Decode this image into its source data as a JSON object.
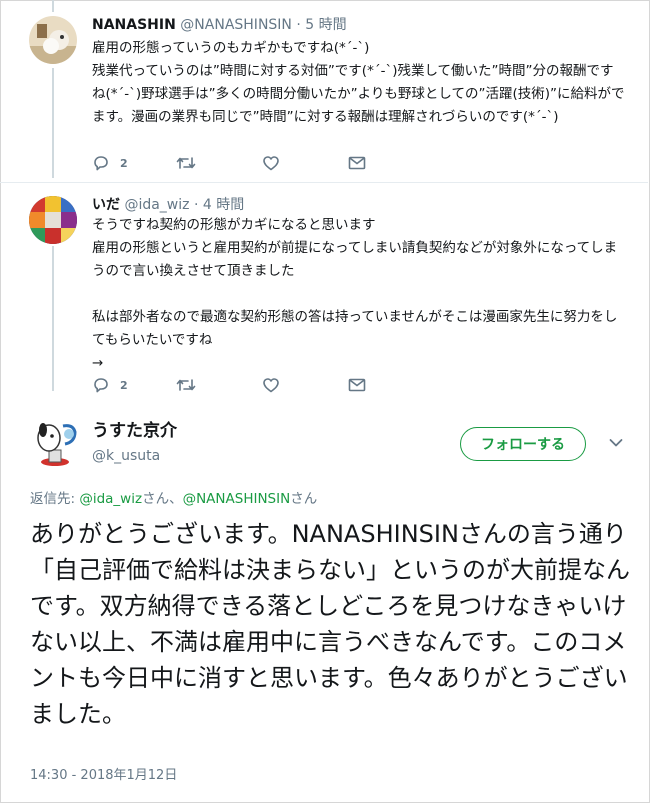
{
  "tweets": [
    {
      "display_name": "NANASHIN",
      "handle": "@NANASHINSIN",
      "time": "5 時間",
      "text": "雇用の形態っていうのもカギかもですね(*´-`)\n残業代っていうのは”時間に対する対価”です(*´-`)残業して働いた”時間”分の報酬ですね(*´-`)野球選手は”多くの時間分働いたか”よりも野球としての”活躍(技術)”に給料がでます。漫画の業界も同じで”時間”に対する報酬は理解されづらいのです(*´-`)",
      "reply_count": "2"
    },
    {
      "display_name": "いだ",
      "handle": "@ida_wiz",
      "time": "4 時間",
      "text": "そうですね契約の形態がカギになると思います\n雇用の形態というと雇用契約が前提になってしまい請負契約などが対象外になってしまうので言い換えさせて頂きました\n\n私は部外者なので最適な契約形態の答は持っていませんがそこは漫画家先生に努力をしてもらいたいですね\n→",
      "reply_count": "2"
    }
  ],
  "main_tweet": {
    "display_name": "うすた京介",
    "handle": "@k_usuta",
    "follow_label": "フォローする",
    "replying_label": "返信先: ",
    "replying_to_1": "@ida_wiz",
    "replying_sep": "さん、",
    "replying_to_2": "@NANASHINSIN",
    "replying_suffix": "さん",
    "text": "ありがとうございます。NANASHINSINさんの言う通り「自己評価で給料は決まらない」というのが大前提なんです。双方納得できる落としどころを見つけなきゃいけない以上、不満は雇用中に言うべきなんです。このコメントも今日中に消すと思います。色々ありがとうございました。",
    "timestamp": "14:30 - 2018年1月12日"
  },
  "icons": [
    "reply-icon",
    "retweet-icon",
    "like-icon",
    "message-icon",
    "chevron-down-icon"
  ],
  "colors": {
    "text": "#14171a",
    "secondary": "#657786",
    "accent_green": "#1a9b43",
    "thread_line": "#cfd9de"
  }
}
